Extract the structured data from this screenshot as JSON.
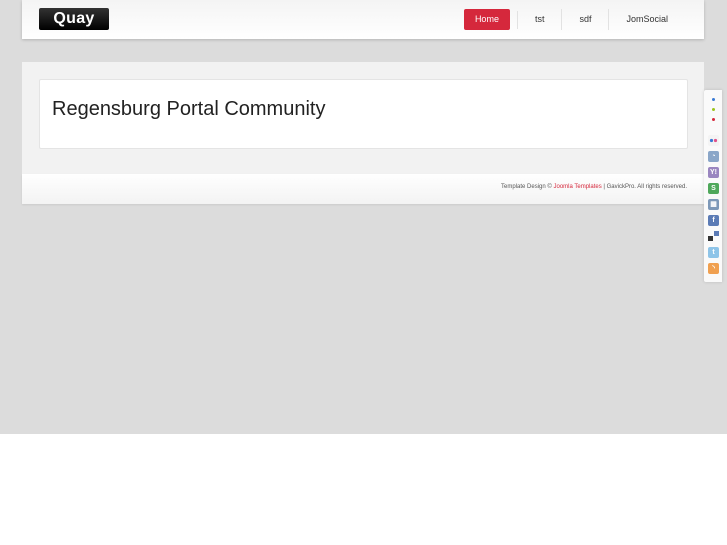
{
  "header": {
    "logo_text": "Quay",
    "nav": [
      {
        "label": "Home",
        "active": true
      },
      {
        "label": "tst",
        "active": false
      },
      {
        "label": "sdf",
        "active": false
      },
      {
        "label": "JomSocial",
        "active": false
      }
    ]
  },
  "main": {
    "title": "Regensburg Portal Community"
  },
  "footer": {
    "prefix": "Template Design © ",
    "link_text": "Joomla Templates",
    "suffix": " | GavickPro. All rights reserved."
  },
  "style_switcher": {
    "colors": [
      "#3a7bd5",
      "#9ac31c",
      "#d5283c"
    ]
  },
  "social": {
    "icons": [
      "flickr-icon",
      "delicious-icon",
      "yahoo-icon",
      "stumbleupon-icon",
      "myspace-icon",
      "facebook-icon",
      "digg-icon",
      "twitter-icon",
      "rss-icon"
    ]
  },
  "colors": {
    "accent": "#d5283c",
    "page_background": "#dcdcdc"
  }
}
